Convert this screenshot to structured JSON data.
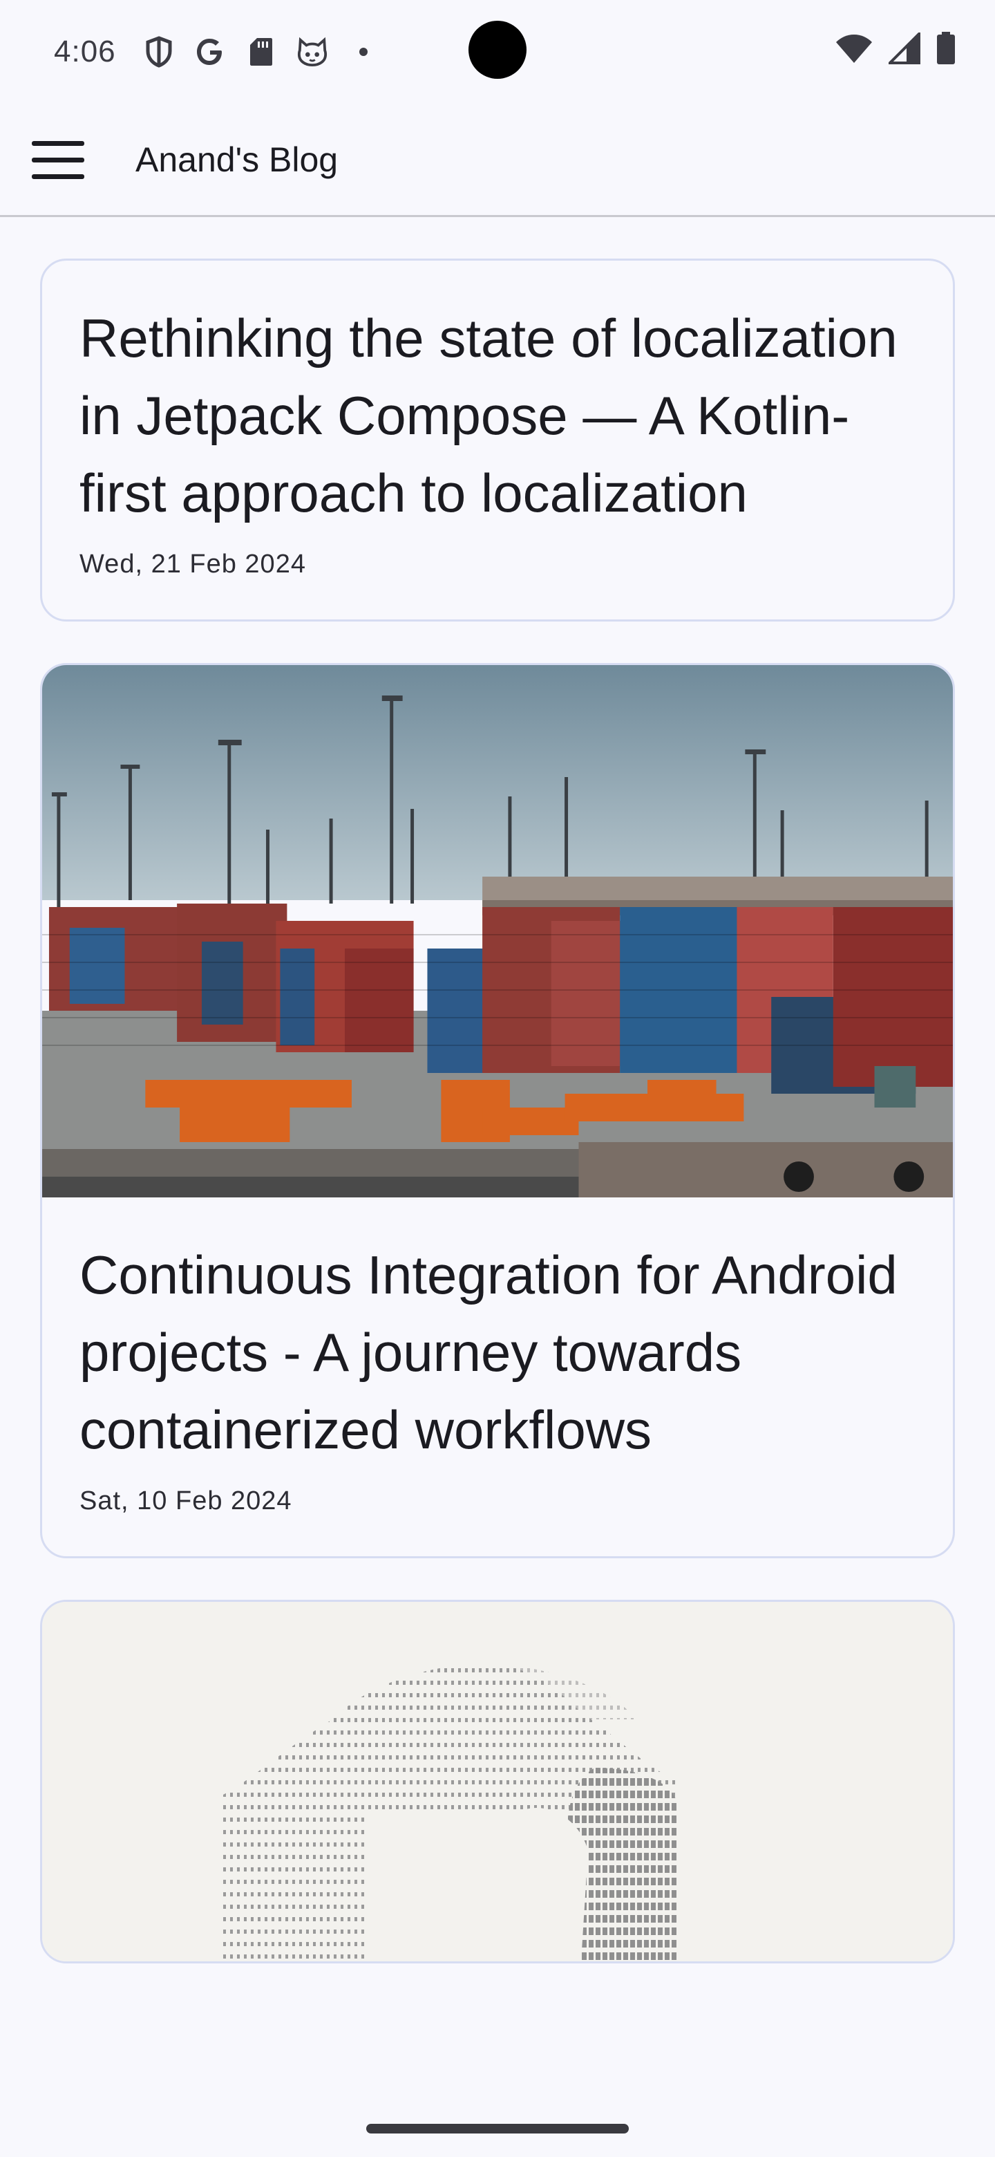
{
  "status_bar": {
    "time": "4:06",
    "left_icons": [
      "shield-icon",
      "google-icon",
      "sd-card-icon",
      "cat-face-icon",
      "dot-icon"
    ],
    "right_icons": [
      "wifi-icon",
      "cell-signal-icon",
      "battery-icon"
    ]
  },
  "app_bar": {
    "menu_icon": "hamburger-menu-icon",
    "title": "Anand's Blog"
  },
  "posts": [
    {
      "title": "Rethinking the state of localization in Jetpack Compose — A Kotlin-first approach to localization",
      "date": "Wed, 21 Feb 2024",
      "has_image": false
    },
    {
      "title": "Continuous Integration for Android projects - A journey towards containerized workflows",
      "date": "Sat, 10 Feb 2024",
      "has_image": true,
      "image": "shipping-container-port-photo"
    },
    {
      "image": "ascii-art-logo"
    }
  ],
  "colors": {
    "background": "#f8f8fd",
    "card_border": "#d6dcf2",
    "text": "#1b1b21"
  }
}
